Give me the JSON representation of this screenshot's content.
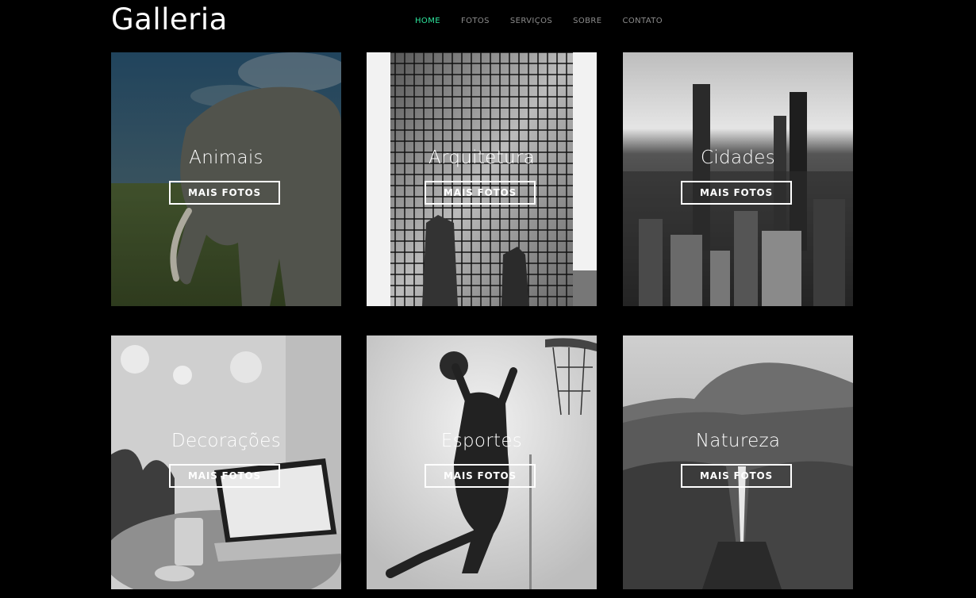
{
  "brand": "Galleria",
  "nav": {
    "home": "HOME",
    "fotos": "FOTOS",
    "servicos": "SERVIÇOS",
    "sobre": "SOBRE",
    "contato": "CONTATO",
    "active": "HOME"
  },
  "colors": {
    "background": "#000000",
    "accent": "#2ee59d",
    "nav_text": "#8c8c8c",
    "text": "#ffffff"
  },
  "cards": [
    {
      "title": "Animais",
      "button": "MAIS FOTOS"
    },
    {
      "title": "Arquitetura",
      "button": "MAIS FOTOS"
    },
    {
      "title": "Cidades",
      "button": "MAIS FOTOS"
    },
    {
      "title": "Decorações",
      "button": "MAIS FOTOS"
    },
    {
      "title": "Esportes",
      "button": "MAIS FOTOS"
    },
    {
      "title": "Natureza",
      "button": "MAIS FOTOS"
    }
  ]
}
